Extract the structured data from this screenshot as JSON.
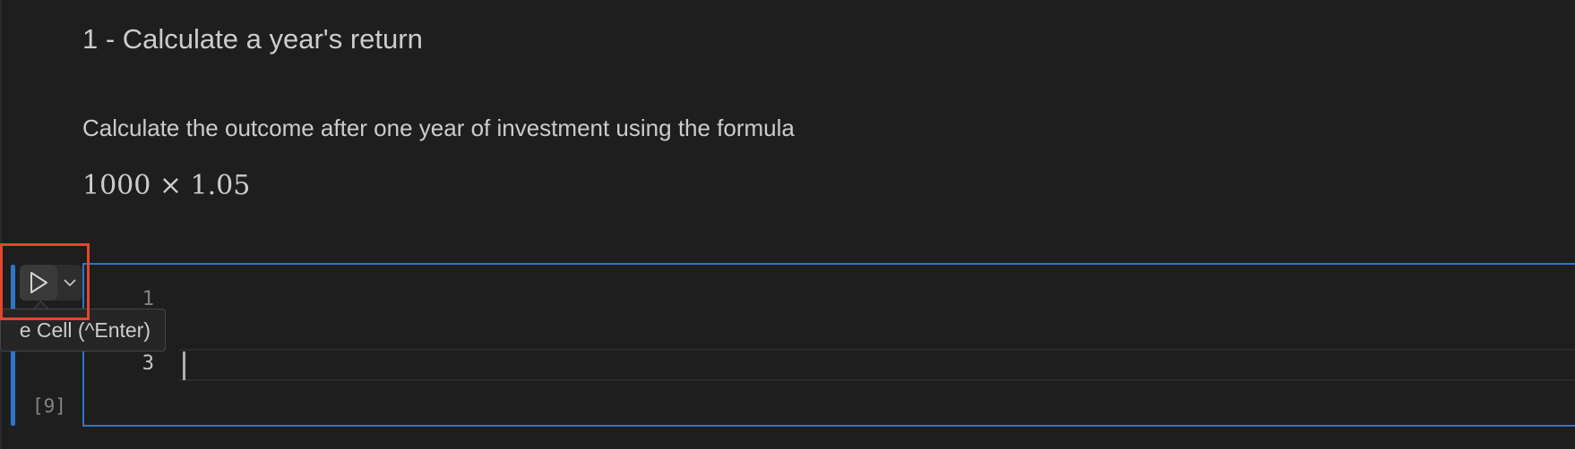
{
  "markdown_cell": {
    "heading": "1 - Calculate a year's return",
    "paragraph": "Calculate the outcome after one year of investment using the formula",
    "math": "1000 × 1.05"
  },
  "code_cell": {
    "run_button_icon": "play-icon",
    "run_menu_icon": "chevron-down-icon",
    "tooltip": "e Cell (^Enter)",
    "line_numbers": [
      "1",
      "3"
    ],
    "execution_count": "[9]"
  },
  "colors": {
    "background": "#1e1e1e",
    "focus_accent": "#2f75c8",
    "highlight": "#e4462f",
    "text": "#cccccc"
  }
}
